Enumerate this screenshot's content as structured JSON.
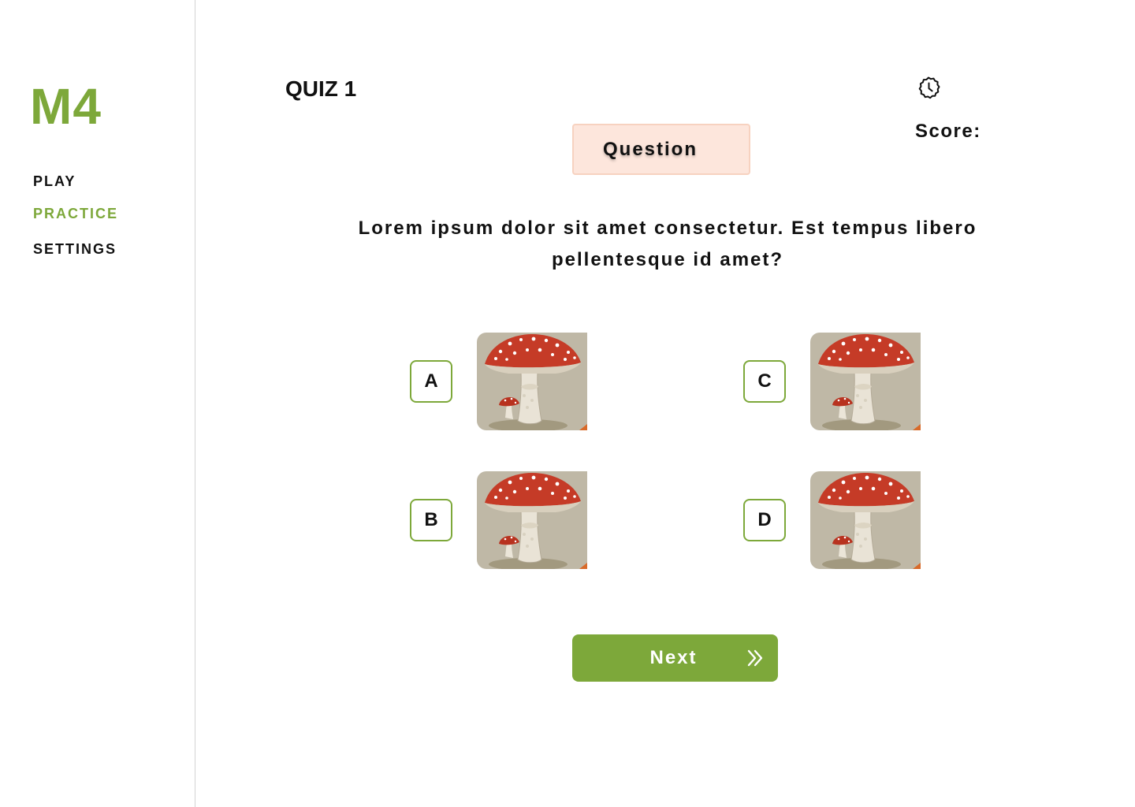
{
  "sidebar": {
    "logo": "M4",
    "items": [
      {
        "label": "PLAY",
        "active": false
      },
      {
        "label": "PRACTICE",
        "active": true
      },
      {
        "label": "SETTINGS",
        "active": false
      }
    ]
  },
  "header": {
    "quiz_title": "QUIZ 1",
    "timer_icon": "clock-icon",
    "score_label": "Score:"
  },
  "question": {
    "chip_label": "Question",
    "text": "Lorem ipsum dolor sit amet consectetur. Est tempus libero pellentesque id amet?"
  },
  "answers": [
    {
      "letter": "A",
      "image": "fly-agaric-mushroom"
    },
    {
      "letter": "B",
      "image": "fly-agaric-mushroom"
    },
    {
      "letter": "C",
      "image": "fly-agaric-mushroom"
    },
    {
      "letter": "D",
      "image": "fly-agaric-mushroom"
    }
  ],
  "next_button": {
    "label": "Next",
    "icon": "double-chevron-right-icon"
  },
  "colors": {
    "accent": "#7da83a",
    "chip_bg": "#fde6dc",
    "chip_border": "#f7d2c0",
    "text": "#111111",
    "divider": "#d3d3d3"
  }
}
